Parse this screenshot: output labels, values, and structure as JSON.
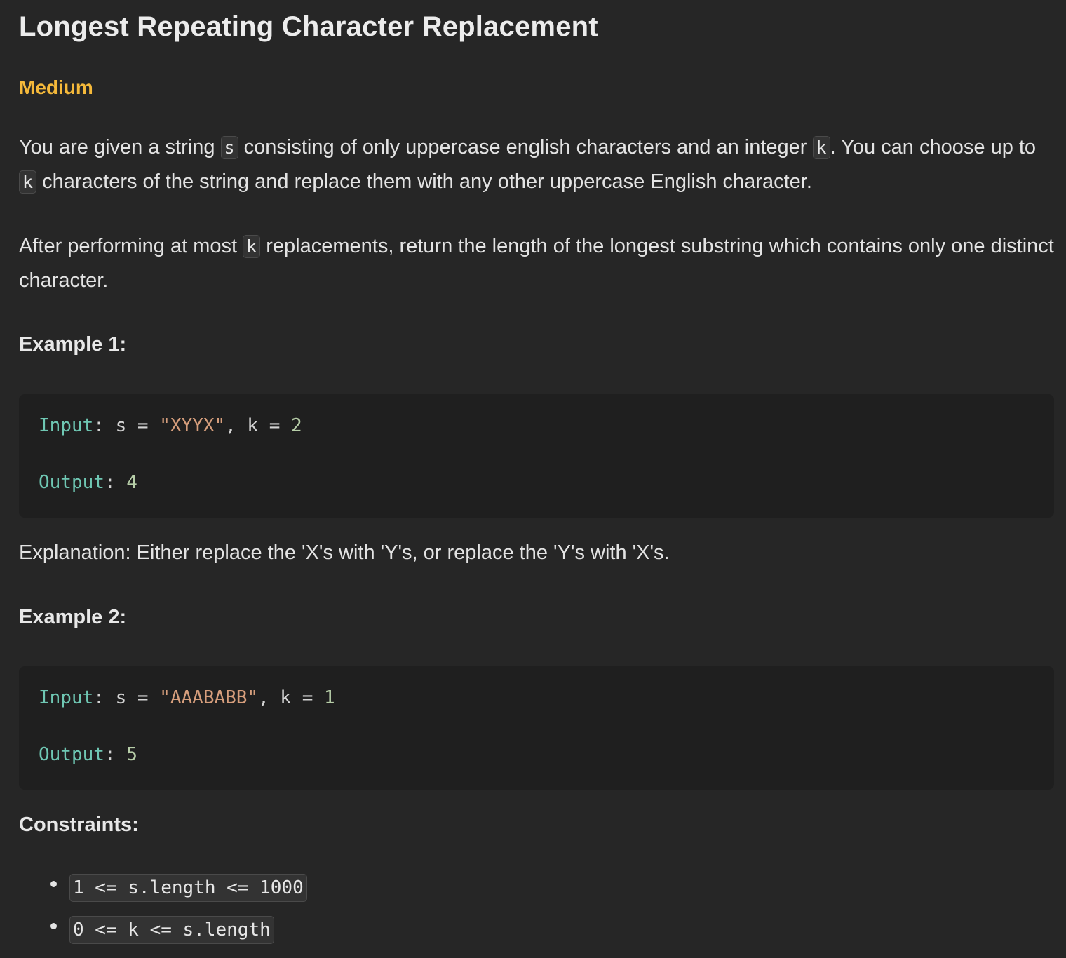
{
  "problem": {
    "title": "Longest Repeating Character Replacement",
    "difficulty": "Medium",
    "colors": {
      "difficulty": "#f5b93a",
      "background": "#262626",
      "code_background": "#1f1f1f",
      "keyword": "#6fc7b3",
      "string": "#d69e7c",
      "number": "#b7cea8"
    },
    "description": {
      "p1_a": "You are given a string ",
      "p1_code1": "s",
      "p1_b": " consisting of only uppercase english characters and an integer ",
      "p1_code2": "k",
      "p1_c": ". You can choose up to ",
      "p1_code3": "k",
      "p1_d": " characters of the string and replace them with any other uppercase English character.",
      "p2_a": "After performing at most ",
      "p2_code1": "k",
      "p2_b": " replacements, return the length of the longest substring which contains only one distinct character."
    },
    "examples": [
      {
        "heading": "Example 1:",
        "input_label": "Input",
        "input_s_prefix": ": s = ",
        "input_s_value": "\"XYYX\"",
        "input_k_prefix": ", k = ",
        "input_k_value": "2",
        "output_label": "Output",
        "output_sep": ": ",
        "output_value": "4",
        "explanation": "Explanation: Either replace the 'X's with 'Y's, or replace the 'Y's with 'X's."
      },
      {
        "heading": "Example 2:",
        "input_label": "Input",
        "input_s_prefix": ": s = ",
        "input_s_value": "\"AAABABB\"",
        "input_k_prefix": ", k = ",
        "input_k_value": "1",
        "output_label": "Output",
        "output_sep": ": ",
        "output_value": "5"
      }
    ],
    "constraints_heading": "Constraints:",
    "constraints": [
      "1 <= s.length <= 1000",
      "0 <= k <= s.length"
    ]
  }
}
